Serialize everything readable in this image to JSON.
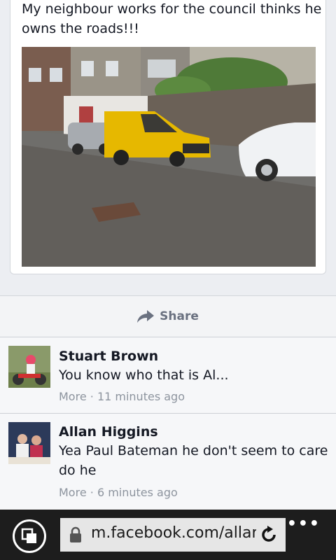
{
  "post": {
    "text": "My neighbour works for the council thinks he owns the roads!!!",
    "photo_icon": "street-photo"
  },
  "share": {
    "label": "Share",
    "icon": "share-arrow-icon"
  },
  "comments": [
    {
      "name": "Stuart Brown",
      "text": "You know who that is Al...",
      "more": "More",
      "separator": " · ",
      "time": "11 minutes ago"
    },
    {
      "name": "Allan Higgins",
      "text": "Yea Paul Bateman he don't seem to care do he",
      "more": "More",
      "separator": " · ",
      "time": "6 minutes ago"
    }
  ],
  "browser": {
    "url": "m.facebook.com/allan",
    "menu": "•••"
  },
  "colors": {
    "bar_bg": "#1d1d1d",
    "meta_grey": "#8d949e",
    "share_grey": "#6a7180"
  }
}
